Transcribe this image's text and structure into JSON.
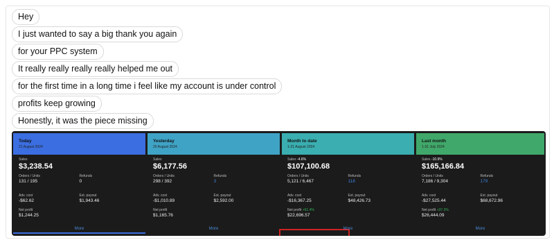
{
  "messages": [
    "Hey",
    "I just wanted to say a big thank you again",
    "for your PPC system",
    "It really really really really helped me out",
    "for the first time in a long time i feel like my account is under control",
    "profits keep growing",
    "Honestly, it was the piece missing"
  ],
  "cards": [
    {
      "title": "Today",
      "date": "21 August 2024",
      "header_color": "#3b6ee0",
      "sales_label": "Sales",
      "sales_change": "",
      "sales": "$3,238.54",
      "orders_label": "Orders / Units",
      "orders": "131 / 195",
      "refunds_label": "Refunds",
      "refunds": "0",
      "ads_label": "Adv. cost",
      "ads": "-$62.62",
      "payout_label": "Est. payout",
      "payout": "$1,943.46",
      "profit_label": "Net profit",
      "profit_change": "",
      "profit": "$1,244.25",
      "more": "More"
    },
    {
      "title": "Yesterday",
      "date": "20 August 2024",
      "header_color": "#3fa3c6",
      "sales_label": "Sales",
      "sales_change": "",
      "sales": "$6,177.56",
      "orders_label": "Orders / Units",
      "orders": "298 / 392",
      "refunds_label": "Refunds",
      "refunds": "3",
      "ads_label": "Adv. cost",
      "ads": "-$1,010.89",
      "payout_label": "Est. payout",
      "payout": "$2,592.00",
      "profit_label": "Net profit",
      "profit_change": "",
      "profit": "$1,165.76",
      "more": "More"
    },
    {
      "title": "Month to date",
      "date": "1-21 August 2024",
      "header_color": "#3aaeb0",
      "sales_label": "Sales",
      "sales_change": "-4.6%",
      "sales": "$107,100.68",
      "orders_label": "Orders / Units",
      "orders": "5,121 / 6,467",
      "refunds_label": "Refunds",
      "refunds": "118",
      "ads_label": "Adv. cost",
      "ads": "-$16,367.25",
      "payout_label": "Est. payout",
      "payout": "$48,426.73",
      "profit_label": "Net profit",
      "profit_change": "+61.4%",
      "profit": "$22,696.57",
      "more": "More"
    },
    {
      "title": "Last month",
      "date": "1-31 July 2024",
      "header_color": "#40a86a",
      "sales_label": "Sales",
      "sales_change": "-10.9%",
      "sales": "$165,166.84",
      "orders_label": "Orders / Units",
      "orders": "7,186 / 9,304",
      "refunds_label": "Refunds",
      "refunds": "179",
      "ads_label": "Adv. cost",
      "ads": "-$27,525.44",
      "payout_label": "Est. payout",
      "payout": "$68,672.96",
      "profit_label": "Net profit",
      "profit_change": "+37.3%",
      "profit": "$26,444.09",
      "more": "More"
    }
  ],
  "highlight_color": "#d12323"
}
